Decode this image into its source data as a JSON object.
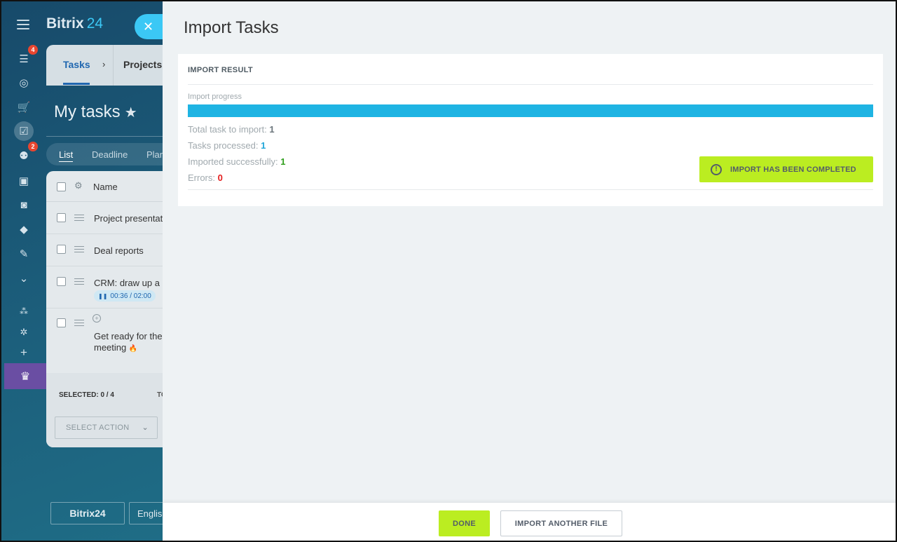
{
  "app": {
    "logo_text": "Bitrix",
    "logo_num": "24"
  },
  "sidebar": {
    "items": [
      {
        "icon": "filter-icon",
        "glyph": "☰",
        "badge": "4"
      },
      {
        "icon": "target-icon",
        "glyph": "◎",
        "badge": ""
      },
      {
        "icon": "cart-icon",
        "glyph": "🛒",
        "badge": ""
      },
      {
        "icon": "tasks-icon",
        "glyph": "☑",
        "badge": "",
        "active": true
      },
      {
        "icon": "crm-icon",
        "glyph": "⚉",
        "badge": "2"
      },
      {
        "icon": "contact-card-icon",
        "glyph": "▣",
        "badge": ""
      },
      {
        "icon": "robot-icon",
        "glyph": "◙",
        "badge": ""
      },
      {
        "icon": "box-icon",
        "glyph": "◆",
        "badge": ""
      },
      {
        "icon": "signature-icon",
        "glyph": "✎",
        "badge": ""
      },
      {
        "icon": "more-icon",
        "glyph": "⌄",
        "badge": ""
      },
      {
        "icon": "sites-icon",
        "glyph": "⁂",
        "badge": ""
      },
      {
        "icon": "settings-icon",
        "glyph": "✲",
        "badge": ""
      },
      {
        "icon": "add-icon",
        "glyph": "+",
        "badge": ""
      }
    ]
  },
  "background_app": {
    "tabs": {
      "tasks": "Tasks",
      "arrow": "›",
      "projects": "Projects"
    },
    "title": "My tasks",
    "views": [
      "List",
      "Deadline",
      "Plan"
    ],
    "grid": {
      "column_name": "Name",
      "rows": [
        {
          "text": "Project presentation"
        },
        {
          "text": "Deal reports"
        },
        {
          "text": "CRM: draw up a",
          "timer": "00:36 / 02:00"
        },
        {
          "text": "Get ready for the",
          "text2": "meeting"
        }
      ],
      "selected": "SELECTED: 0 / 4",
      "total_prefix": "TOTAL",
      "select_action": "SELECT ACTION"
    },
    "footer": {
      "brand": "Bitrix24",
      "lang": "English"
    }
  },
  "panel": {
    "title": "Import Tasks",
    "card_header": "IMPORT RESULT",
    "progress_label": "Import progress",
    "progress_percent": 100,
    "stats": {
      "total_label": "Total task to import:",
      "total_value": "1",
      "processed_label": "Tasks processed:",
      "processed_value": "1",
      "success_label": "Imported successfully:",
      "success_value": "1",
      "errors_label": "Errors:",
      "errors_value": "0"
    },
    "status_label": "IMPORT HAS BEEN COMPLETED",
    "done_label": "DONE",
    "another_label": "IMPORT ANOTHER FILE"
  },
  "colors": {
    "accent_green": "#bbed21",
    "progress_blue": "#1fb4e3",
    "close_blue": "#3bc8f5",
    "error_red": "#e41d1d"
  }
}
